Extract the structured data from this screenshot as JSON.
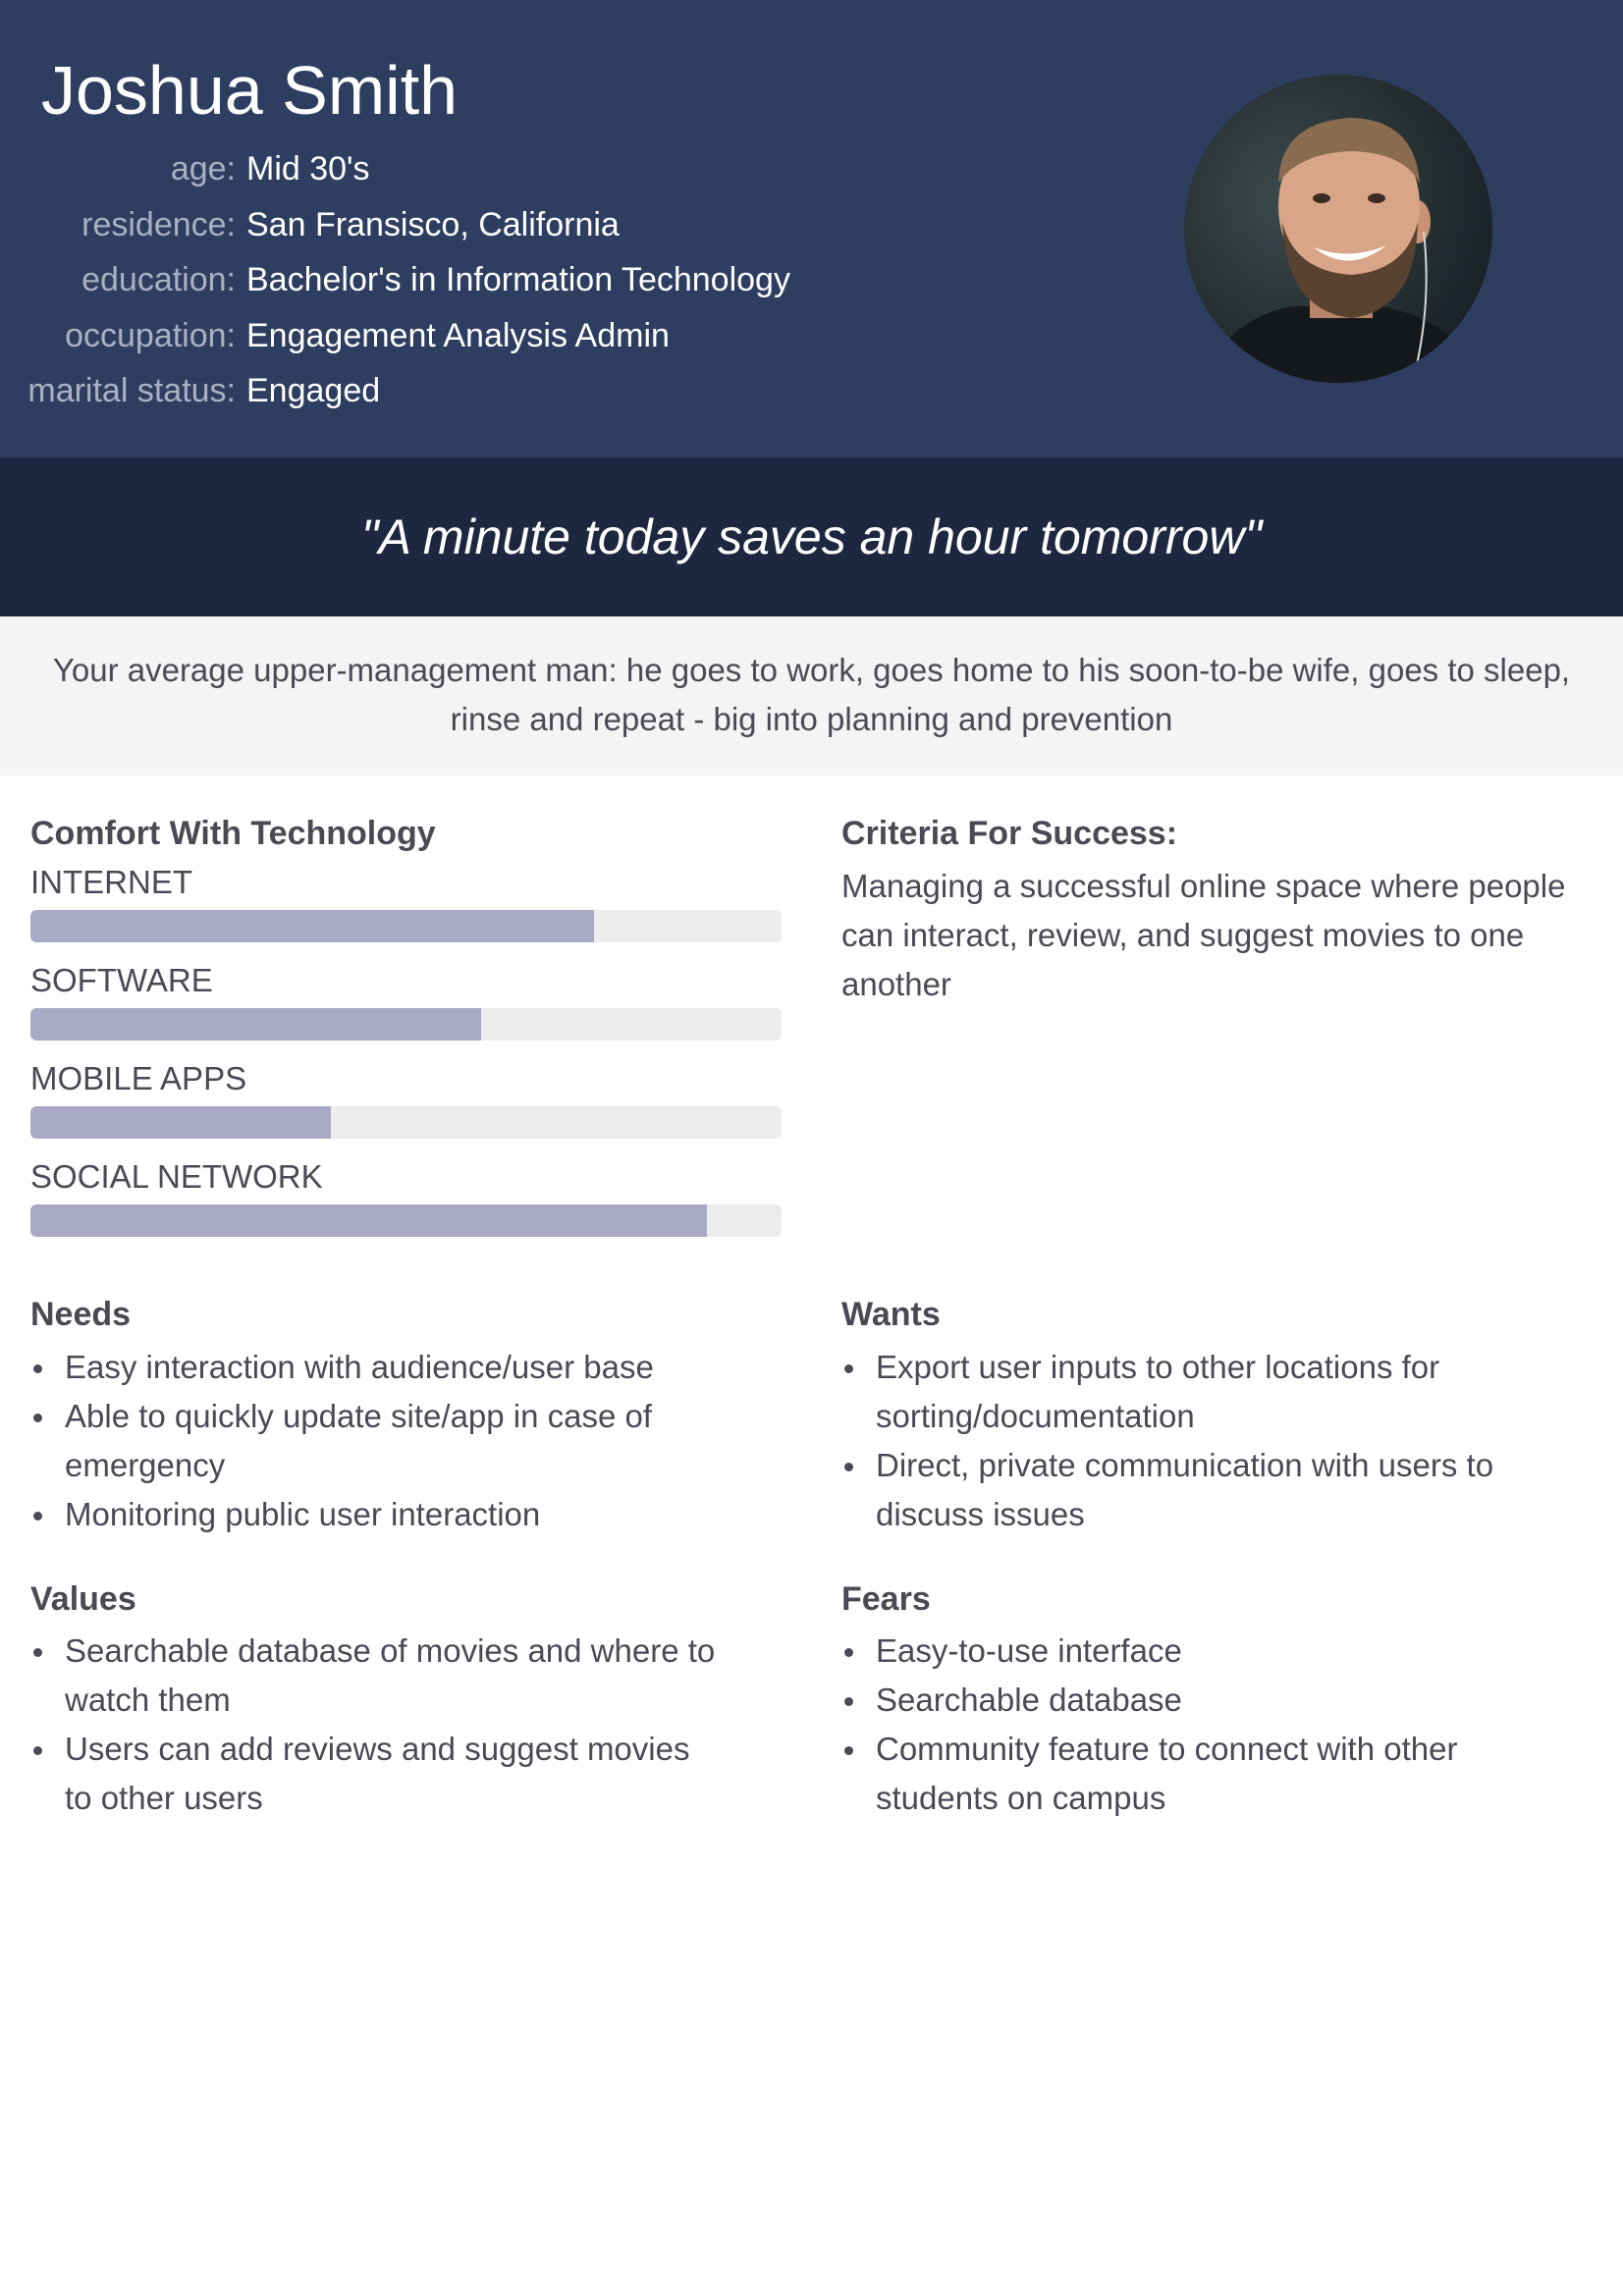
{
  "persona": {
    "name": "Joshua Smith",
    "details": [
      {
        "label": "age:",
        "value": "Mid 30's"
      },
      {
        "label": "residence:",
        "value": "San Fransisco, California"
      },
      {
        "label": "education:",
        "value": "Bachelor's in Information Technology"
      },
      {
        "label": "occupation:",
        "value": "Engagement Analysis Admin"
      },
      {
        "label": "marital status:",
        "value": "Engaged"
      }
    ],
    "photo": "avatar-photo"
  },
  "quote": "\"A minute today saves an hour tomorrow\"",
  "summary": "Your average upper-management man: he goes to work, goes home to his soon-to-be wife, goes to sleep, rinse and repeat - big into planning and prevention",
  "comfort": {
    "title": "Comfort With Technology",
    "skills": [
      {
        "label": "INTERNET",
        "level": 0.75
      },
      {
        "label": "SOFTWARE",
        "level": 0.6
      },
      {
        "label": "MOBILE APPS",
        "level": 0.4
      },
      {
        "label": "SOCIAL NETWORK",
        "level": 0.9
      }
    ]
  },
  "criteria": {
    "title": "Criteria For Success:",
    "text": "Managing a successful online space where people can interact, review, and suggest movies to one another"
  },
  "needs": {
    "title": "Needs",
    "items": [
      "Easy interaction with audience/user base",
      "Able to quickly update site/app in case of emergency",
      "Monitoring public user interaction"
    ]
  },
  "wants": {
    "title": "Wants",
    "items": [
      "Export user inputs to other locations for sorting/documentation",
      "Direct, private communication with users to discuss issues"
    ]
  },
  "values": {
    "title": "Values",
    "items": [
      "Searchable database of movies and where to watch them",
      "Users can add reviews and suggest movies to other users"
    ]
  },
  "fears": {
    "title": "Fears",
    "items": [
      "Easy-to-use interface",
      "Searchable database",
      "Community feature to connect with other students on campus"
    ]
  },
  "colors": {
    "header_bg": "#2d3e60",
    "quote_bg": "#1d2840",
    "summary_bg": "#f4f4f4",
    "bar_fill": "#a9a9c5",
    "bar_track": "#ececec",
    "text": "#4a4a55"
  }
}
